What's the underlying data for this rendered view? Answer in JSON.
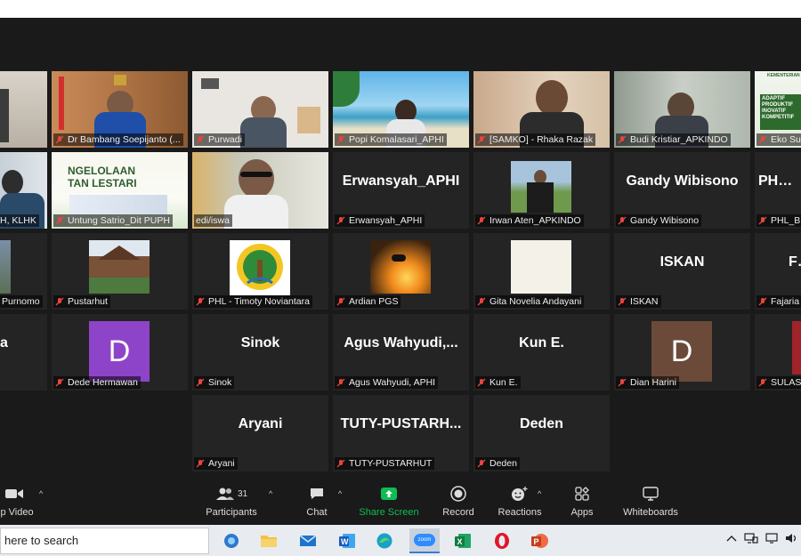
{
  "tiles": [
    {
      "name": "",
      "label": ""
    },
    {
      "name": "Dr Bambang Soepijanto (...",
      "label": "Dr Bambang Soepijanto (..."
    },
    {
      "name": "Purwadi",
      "label": "Purwadi"
    },
    {
      "name": "Popi Komalasari_APHI",
      "label": "Popi Komalasari_APHI"
    },
    {
      "name": "[SAMKO] - Rhaka Razak",
      "label": "[SAMKO] - Rhaka Razak"
    },
    {
      "name": "Budi Kristiar_APKINDO",
      "label": "Budi Kristiar_APKINDO"
    },
    {
      "name": "Eko Su",
      "label": "Eko Su"
    },
    {
      "name": "H, KLHK",
      "label": "H, KLHK"
    },
    {
      "name": "Untung Satrio_Dit PUPH",
      "label": "Untung Satrio_Dit PUPH",
      "slide": "NGELOLAAN\nTAN LESTARI"
    },
    {
      "name": "edi/iswa",
      "label": "edi/iswa"
    },
    {
      "name": "Erwansyah_APHI",
      "label": "Erwansyah_APHI",
      "big": "Erwansyah_APHI"
    },
    {
      "name": "Irwan Aten_APKINDO",
      "label": "Irwan Aten_APKINDO"
    },
    {
      "name": "Gandy Wibisono",
      "label": "Gandy Wibisono",
      "big": "Gandy Wibisono"
    },
    {
      "name": "PHL_BR",
      "label": "PHL_BR",
      "big": "PHL_B"
    },
    {
      "name": "Purnomo",
      "label": "Purnomo"
    },
    {
      "name": "Pustarhut",
      "label": "Pustarhut"
    },
    {
      "name": "PHL - Timoty Noviantara",
      "label": "PHL - Timoty Noviantara"
    },
    {
      "name": "Ardian PGS",
      "label": "Ardian PGS"
    },
    {
      "name": "Gita Novelia Andayani",
      "label": "Gita Novelia Andayani"
    },
    {
      "name": "ISKAN",
      "label": "ISKAN",
      "big": "ISKAN"
    },
    {
      "name": "Fajaria",
      "label": "Fajaria",
      "big": "Fa"
    },
    {
      "name": "a",
      "label": "",
      "big": "a"
    },
    {
      "name": "Dede Hermawan",
      "label": "Dede Hermawan",
      "avatar": "D"
    },
    {
      "name": "Sinok",
      "label": "Sinok",
      "big": "Sinok"
    },
    {
      "name": "Agus Wahyudi, APHI",
      "label": "Agus Wahyudi, APHI",
      "big": "Agus  Wahyudi,..."
    },
    {
      "name": "Kun E.",
      "label": "Kun E.",
      "big": "Kun E."
    },
    {
      "name": "Dian Harini",
      "label": "Dian Harini",
      "avatar": "D"
    },
    {
      "name": "SULASW",
      "label": "SULASW"
    },
    {
      "name": "Aryani",
      "label": "Aryani",
      "big": "Aryani"
    },
    {
      "name": "TUTY-PUSTARHUT",
      "label": "TUTY-PUSTARHUT",
      "big": "TUTY-PUSTARH..."
    },
    {
      "name": "Deden",
      "label": "Deden",
      "big": "Deden"
    }
  ],
  "slide_text": {
    "eko_header": "KEMENTERIAN",
    "eko_line1": "ADAPTIF",
    "eko_line2": "PRODUKTIF",
    "eko_line3": "INOVATIF",
    "eko_line4": "KOMPETITIF"
  },
  "toolbar": {
    "video_label": "op Video",
    "participants_label": "Participants",
    "participants_count": "31",
    "chat_label": "Chat",
    "share_label": "Share Screen",
    "record_label": "Record",
    "reactions_label": "Reactions",
    "apps_label": "Apps",
    "whiteboards_label": "Whiteboards"
  },
  "taskbar": {
    "search_placeholder": "here to search",
    "zoom_label": "zoom"
  },
  "colors": {
    "meeting_bg": "#1a1a1a",
    "tile_bg": "#242424",
    "active_speaker": "#b7e22a",
    "share_green": "#0ebd53",
    "mic_off_red": "#e8453c",
    "avatar_dede": "#8e44c8",
    "avatar_dian": "#6b4a3a"
  }
}
